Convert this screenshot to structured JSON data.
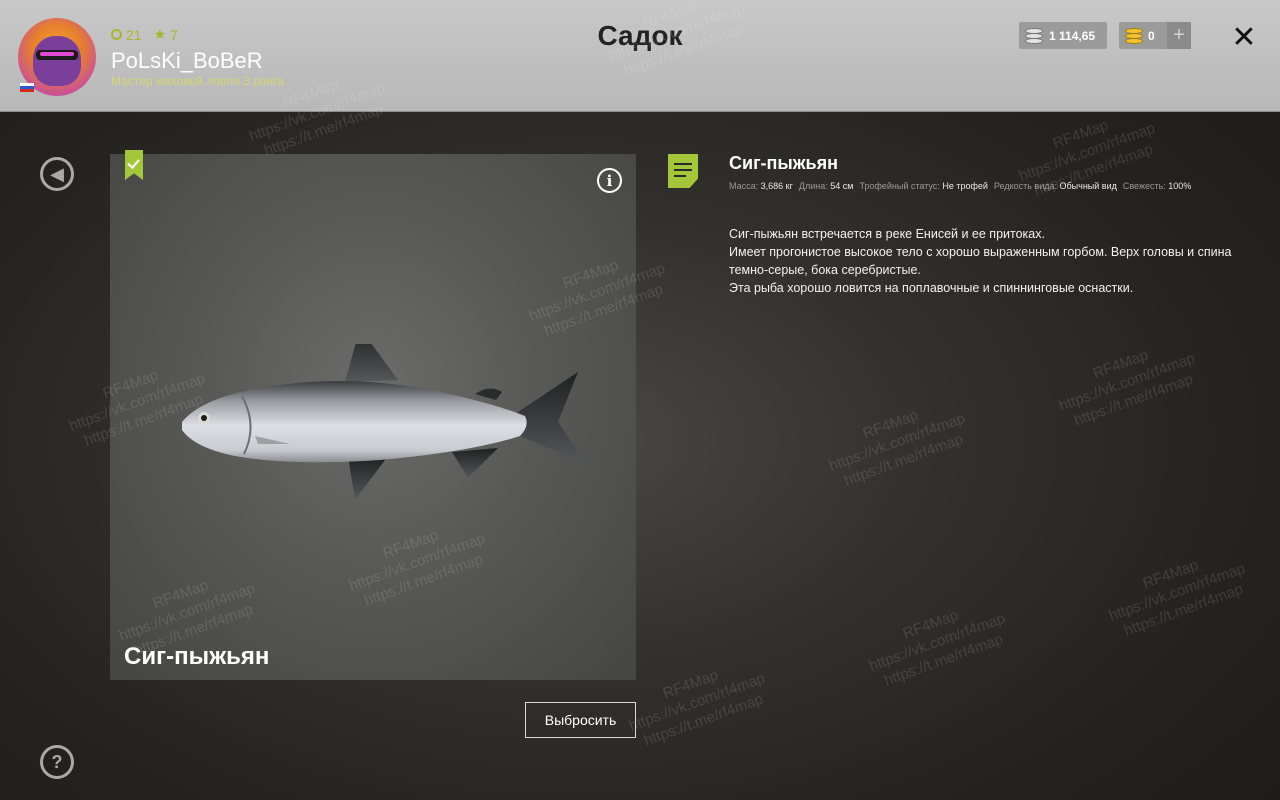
{
  "header": {
    "title": "Садок",
    "player": {
      "name": "PoLsKi_BoBeR",
      "rank_text": "Мастер маховой ловли 3 ранга",
      "stat_level": "21",
      "stat_stars": "7"
    },
    "silver": "1 114,65",
    "gold": "0",
    "plus_label": "+",
    "close_label": "✕"
  },
  "card": {
    "title": "Сиг-пыжьян",
    "info_label": "i"
  },
  "details": {
    "name": "Сиг-пыжьян",
    "props": [
      {
        "label": "Масса:",
        "value": "3,686 кг"
      },
      {
        "label": "Длина:",
        "value": "54 см"
      },
      {
        "label": "Трофейный статус:",
        "value": "Не трофей"
      },
      {
        "label": "Редкость вида:",
        "value": "Обычный вид"
      },
      {
        "label": "Свежесть:",
        "value": "100%"
      }
    ],
    "description": [
      "Сиг-пыжьян встречается в реке Енисей и ее притоках.",
      "Имеет прогонистое высокое тело с хорошо выраженным горбом. Верх головы и спина темно-серые, бока серебристые.",
      "Эта рыба хорошо ловится на поплавочные и спиннинговые оснастки."
    ]
  },
  "actions": {
    "release_label": "Выбросить",
    "back_label": "◀",
    "help_label": "?"
  },
  "watermark": {
    "line1": "RF4Map",
    "line2": "https://vk.com/rf4map",
    "line3": "https://t.me/rf4map"
  },
  "icons": {
    "level": "ring-icon",
    "stars": "star-icon",
    "silver": "silver-coins-icon",
    "gold": "gold-coins-icon",
    "bookmark": "bookmark-check-icon",
    "doc": "document-icon"
  },
  "colors": {
    "accent_green": "#a4c639",
    "header_bg": "#bdbdbd",
    "title_dark": "#222222"
  }
}
